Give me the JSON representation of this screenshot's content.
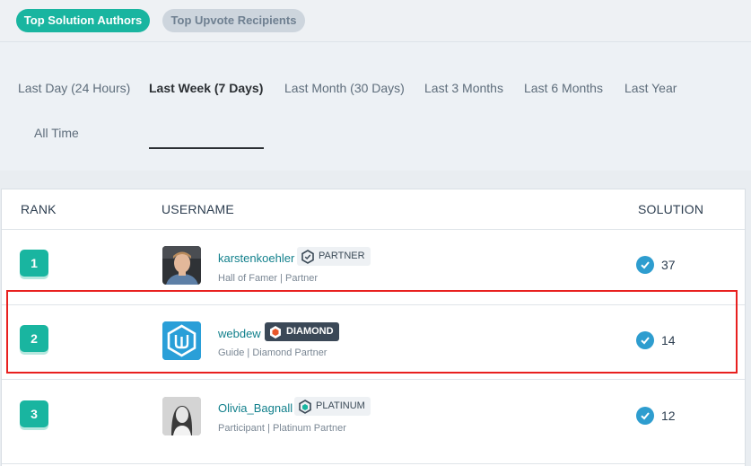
{
  "toggle": {
    "active_label": "Top Solution Authors",
    "inactive_label": "Top Upvote Recipients"
  },
  "periods": [
    {
      "label": "Last Day (24 Hours)",
      "active": false
    },
    {
      "label": "Last Week (7 Days)",
      "active": true
    },
    {
      "label": "Last Month (30 Days)",
      "active": false
    },
    {
      "label": "Last 3 Months",
      "active": false
    },
    {
      "label": "Last 6 Months",
      "active": false
    },
    {
      "label": "Last Year",
      "active": false
    },
    {
      "label": "All Time",
      "active": false
    }
  ],
  "table": {
    "headers": {
      "rank": "RANK",
      "username": "USERNAME",
      "solution": "SOLUTION"
    },
    "rows": [
      {
        "rank": "1",
        "username": "karstenkoehler",
        "badge": "PARTNER",
        "subtitle": "Hall of Famer | Partner",
        "solutions": "37",
        "avatar_icon": "user-photo-icon"
      },
      {
        "rank": "2",
        "username": "webdew",
        "badge": "DIAMOND",
        "subtitle": "Guide | Diamond Partner",
        "solutions": "14",
        "avatar_icon": "webdew-logo-icon"
      },
      {
        "rank": "3",
        "username": "Olivia_Bagnall",
        "badge": "PLATINUM",
        "subtitle": "Participant | Platinum Partner",
        "solutions": "12",
        "avatar_icon": "user-photo-icon"
      }
    ]
  },
  "colors": {
    "accent": "#19b5a0",
    "link": "#12808c",
    "check": "#2e9dcf",
    "highlight": "#e8201f"
  }
}
